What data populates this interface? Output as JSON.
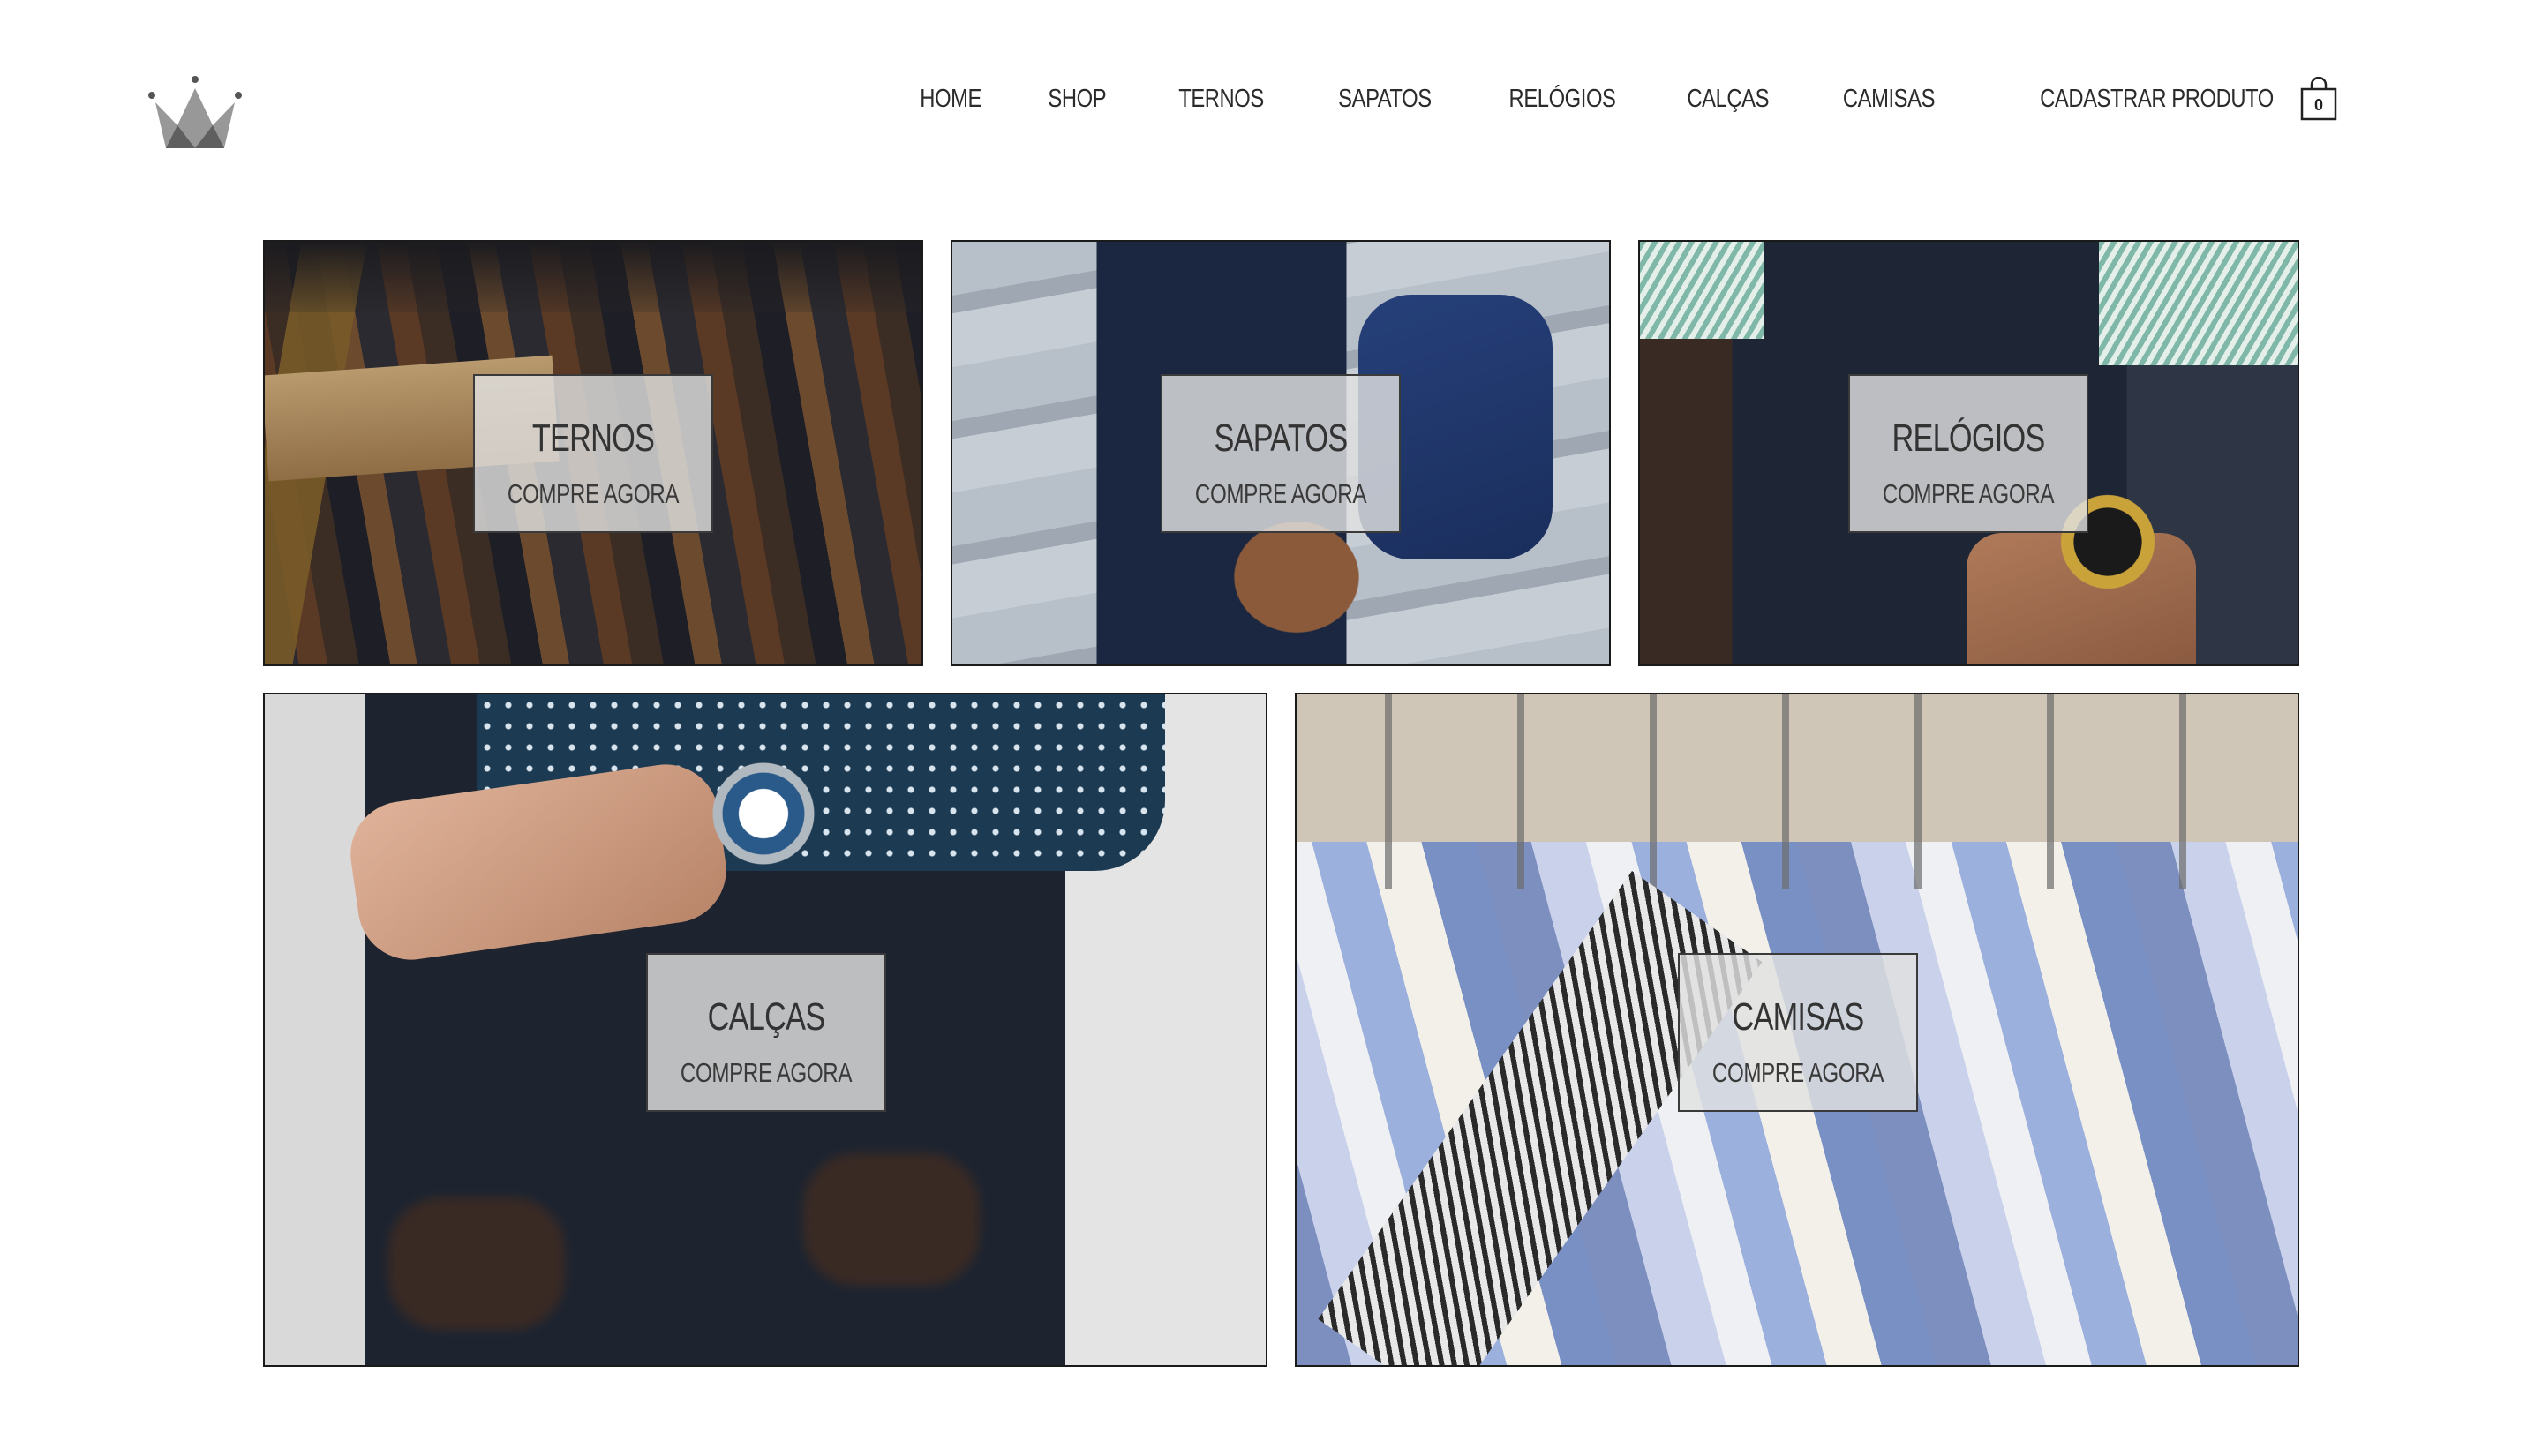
{
  "header": {
    "logo": "crown-logo",
    "nav": [
      {
        "label": "HOME"
      },
      {
        "label": "SHOP"
      },
      {
        "label": "TERNOS"
      },
      {
        "label": "SAPATOS"
      },
      {
        "label": "RELÓGIOS"
      },
      {
        "label": "CALÇAS"
      },
      {
        "label": "CAMISAS"
      },
      {
        "label": "CADASTRAR PRODUTO"
      }
    ],
    "cart": {
      "icon": "shopping-bag-icon",
      "count": "0"
    }
  },
  "categories": [
    {
      "title": "TERNOS",
      "cta": "COMPRE AGORA"
    },
    {
      "title": "SAPATOS",
      "cta": "COMPRE AGORA"
    },
    {
      "title": "RELÓGIOS",
      "cta": "COMPRE AGORA"
    },
    {
      "title": "CALÇAS",
      "cta": "COMPRE AGORA"
    },
    {
      "title": "CAMISAS",
      "cta": "COMPRE AGORA"
    }
  ]
}
